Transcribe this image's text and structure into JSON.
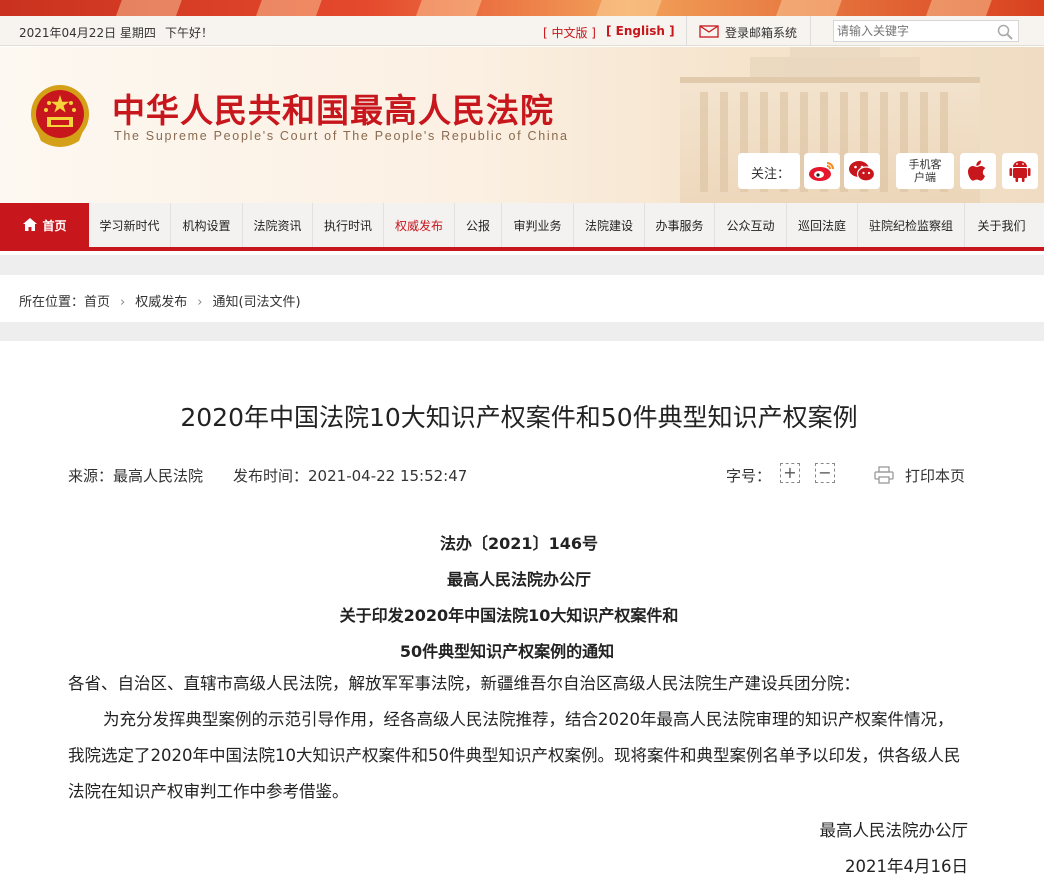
{
  "util": {
    "date": "2021年04月22日 星期四",
    "greeting": "下午好！",
    "lang_zh": "[ 中文版 ]",
    "lang_en": "[ English ]",
    "mail": "登录邮箱系统",
    "search_placeholder": "请输入关键字"
  },
  "header": {
    "site_cn": "中华人民共和国最高人民法院",
    "site_en": "The Supreme People's Court of The People's Republic of China",
    "follow": "关注：",
    "mobile": "手机客户端"
  },
  "nav": [
    "首页",
    "学习新时代",
    "机构设置",
    "法院资讯",
    "执行时讯",
    "权威发布",
    "公报",
    "审判业务",
    "法院建设",
    "办事服务",
    "公众互动",
    "巡回法庭",
    "驻院纪检监察组",
    "关于我们"
  ],
  "breadcrumb": {
    "label": "所在位置：首页",
    "level2": "权威发布",
    "level3": "通知(司法文件)"
  },
  "article": {
    "title": "2020年中国法院10大知识产权案件和50件典型知识产权案例",
    "source": "来源：最高人民法院",
    "published": "发布时间：2021-04-22 15:52:47",
    "fontsize_label": "字号：",
    "increase": "+",
    "decrease": "−",
    "print": "打印本页",
    "doc_no": "法办〔2021〕146号",
    "issuer": "最高人民法院办公厅",
    "heading1": "关于印发2020年中国法院10大知识产权案件和",
    "heading2": "50件典型知识产权案例的通知",
    "addressees": "各省、自治区、直辖市高级人民法院，解放军军事法院，新疆维吾尔自治区高级人民法院生产建设兵团分院：",
    "body": "为充分发挥典型案例的示范引导作用，经各高级人民法院推荐，结合2020年最高人民法院审理的知识产权案件情况，我院选定了2020年中国法院10大知识产权案件和50件典型知识产权案例。现将案件和典型案例名单予以印发，供各级人民法院在知识产权审判工作中参考借鉴。",
    "signer": "最高人民法院办公厅",
    "date": "2021年4月16日"
  },
  "colors": {
    "brand_red": "#c8161d",
    "header_bg": "#fbf0e2"
  }
}
